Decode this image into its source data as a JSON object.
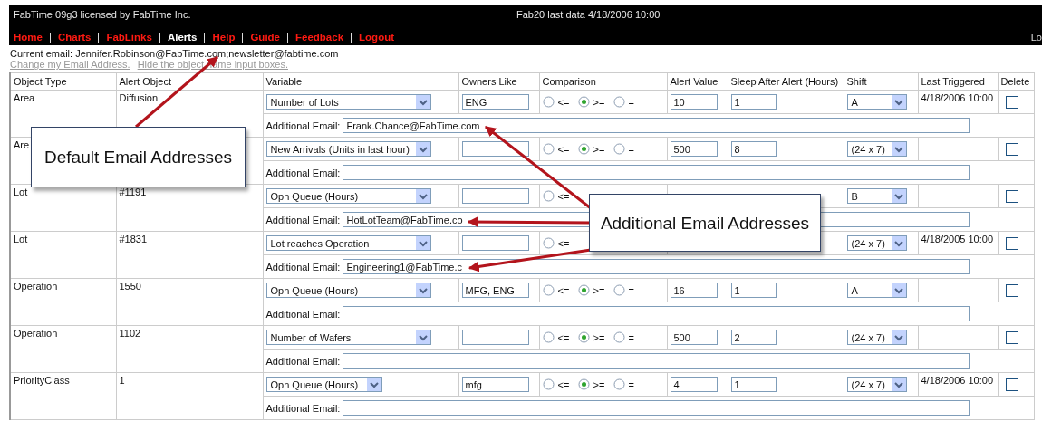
{
  "header": {
    "title": "FabTime 09g3 licensed by FabTime Inc.",
    "last_data": "Fab20 last data 4/18/2006 10:00",
    "right_cut": "Lo"
  },
  "nav": [
    {
      "label": "Home",
      "selected": false
    },
    {
      "label": "Charts",
      "selected": false
    },
    {
      "label": "FabLinks",
      "selected": false
    },
    {
      "label": "Alerts",
      "selected": true
    },
    {
      "label": "Help",
      "selected": false
    },
    {
      "label": "Guide",
      "selected": false
    },
    {
      "label": "Feedback",
      "selected": false
    },
    {
      "label": "Logout",
      "selected": false
    }
  ],
  "current_email": "Current email: Jennifer.Robinson@FabTime.com;newsletter@fabtime.com",
  "links": [
    "Change my Email Address.",
    "Hide the object name input boxes."
  ],
  "table": {
    "columns": [
      "Object Type",
      "Alert Object",
      "Variable",
      "Owners Like",
      "Comparison",
      "Alert Value",
      "Sleep After Alert (Hours)",
      "Shift",
      "Last Triggered",
      "Delete"
    ],
    "rows": [
      {
        "object_type": "Area",
        "alert_object": "Diffusion",
        "variable": "Number of Lots",
        "owners_like": "ENG",
        "comparison": [
          {
            "label": "<=",
            "selected": false
          },
          {
            "label": ">=",
            "selected": true
          },
          {
            "label": "=",
            "selected": false
          }
        ],
        "alert_value": "10",
        "sleep": "1",
        "shift": "A",
        "last_triggered": "4/18/2006 10:00",
        "delete": false,
        "email_label": "Additional Email:",
        "additional_email": "Frank.Chance@FabTime.com"
      },
      {
        "object_type": "Are",
        "variable": "New Arrivals (Units in last hour)",
        "comparison": [
          {
            "label": "<=",
            "selected": false
          },
          {
            "label": ">=",
            "selected": true
          },
          {
            "label": "=",
            "selected": false
          }
        ],
        "alert_value": "500",
        "sleep": "8",
        "shift": "(24 x 7)",
        "delete": false,
        "email_label": "Additional Email:"
      },
      {
        "object_type": "Lot",
        "alert_object": "#1191",
        "variable": "Opn Queue (Hours)",
        "comparison": [
          {
            "label": "<=",
            "selected": false
          }
        ],
        "shift": "B",
        "delete": false,
        "email_label": "Additional Email:",
        "additional_email": "HotLotTeam@FabTime.co"
      },
      {
        "object_type": "Lot",
        "alert_object": "#1831",
        "variable": "Lot reaches Operation",
        "comparison": [
          {
            "label": "<=",
            "selected": false
          }
        ],
        "shift": "(24 x 7)",
        "last_triggered": "4/18/2005 10:00",
        "delete": false,
        "email_label": "Additional Email:",
        "additional_email": "Engineering1@FabTime.c"
      },
      {
        "object_type": "Operation",
        "alert_object": "1550",
        "variable": "Opn Queue (Hours)",
        "owners_like": "MFG, ENG",
        "comparison": [
          {
            "label": "<=",
            "selected": false
          },
          {
            "label": ">=",
            "selected": true
          },
          {
            "label": "=",
            "selected": false
          }
        ],
        "alert_value": "16",
        "sleep": "1",
        "shift": "A",
        "delete": false,
        "email_label": "Additional Email:"
      },
      {
        "object_type": "Operation",
        "alert_object": "1102",
        "variable": "Number of Wafers",
        "comparison": [
          {
            "label": "<=",
            "selected": false
          },
          {
            "label": ">=",
            "selected": true
          },
          {
            "label": "=",
            "selected": false
          }
        ],
        "alert_value": "500",
        "sleep": "2",
        "shift": "(24 x 7)",
        "delete": false,
        "email_label": "Additional Email:"
      },
      {
        "object_type": "PriorityClass",
        "alert_object": "1",
        "variable": "Opn Queue (Hours)",
        "owners_like": "mfg",
        "comparison": [
          {
            "label": "<=",
            "selected": false
          },
          {
            "label": ">=",
            "selected": true
          },
          {
            "label": "=",
            "selected": false
          }
        ],
        "alert_value": "4",
        "sleep": "1",
        "shift": "(24 x 7)",
        "last_triggered": "4/18/2006 10:00",
        "delete": false,
        "email_label": "Additional Email:"
      }
    ]
  },
  "callouts": [
    {
      "text": "Default Email Addresses"
    },
    {
      "text": "Additional Email Addresses"
    }
  ]
}
